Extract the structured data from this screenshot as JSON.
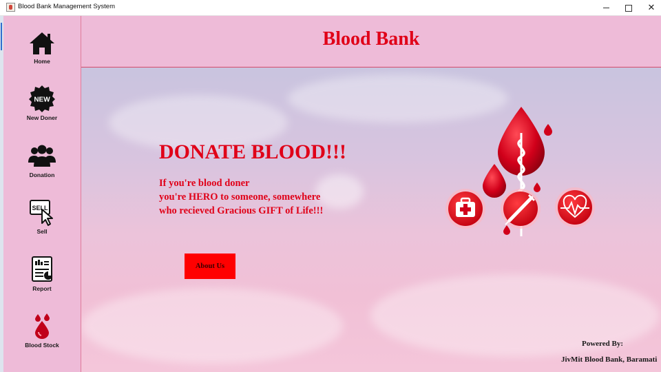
{
  "window": {
    "title": "Blood Bank Management System",
    "controls": [
      "minimize",
      "maximize",
      "close"
    ]
  },
  "sidebar": {
    "items": [
      {
        "label": "Home",
        "icon": "home-icon"
      },
      {
        "label": "New Doner",
        "icon": "new-badge-icon"
      },
      {
        "label": "Donation",
        "icon": "people-group-icon"
      },
      {
        "label": "Sell",
        "icon": "sell-cursor-icon"
      },
      {
        "label": "Report",
        "icon": "report-icon"
      },
      {
        "label": "Blood Stock",
        "icon": "blood-drops-icon"
      }
    ]
  },
  "header": {
    "title": "Blood Bank"
  },
  "main": {
    "headline": "DONATE BLOOD!!!",
    "tagline_lines": [
      "If you're blood doner",
      "you're HERO to someone, somewhere",
      "who recieved Gracious GIFT of Life!!!"
    ],
    "about_button": "About Us",
    "illustration_icons": [
      "blood-drop-icon",
      "medical-kit-icon",
      "syringe-icon",
      "heartbeat-icon"
    ],
    "powered_by_label": "Powered By:",
    "powered_by_org": "JivMit Blood Bank, Baramati"
  },
  "colors": {
    "accent_red": "#e00018",
    "panel_pink": "#eebbd8",
    "button_red": "#ff0000"
  }
}
